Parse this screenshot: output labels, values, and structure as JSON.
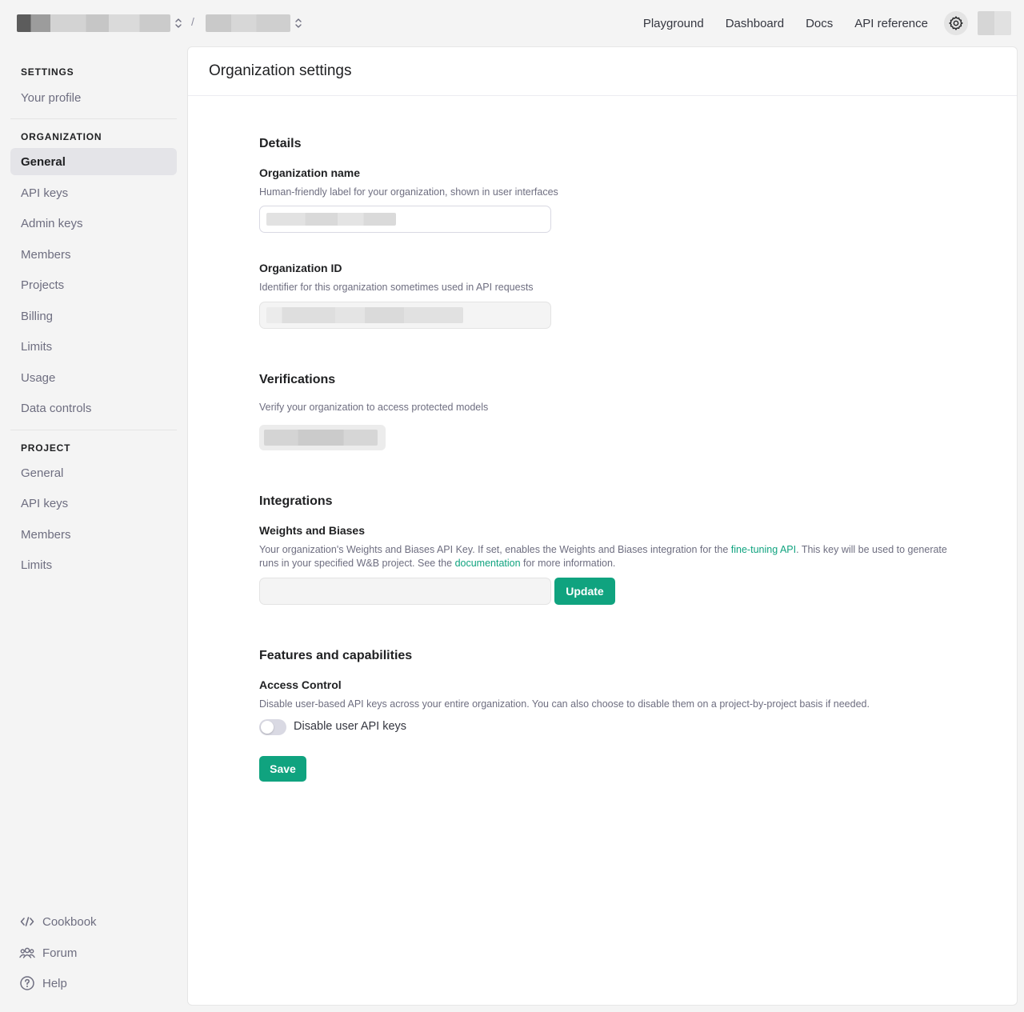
{
  "topnav": {
    "links": [
      "Playground",
      "Dashboard",
      "Docs",
      "API reference"
    ]
  },
  "sidebar": {
    "settings_heading": "SETTINGS",
    "your_profile": "Your profile",
    "organization_heading": "ORGANIZATION",
    "organization_items": [
      "General",
      "API keys",
      "Admin keys",
      "Members",
      "Projects",
      "Billing",
      "Limits",
      "Usage",
      "Data controls"
    ],
    "project_heading": "PROJECT",
    "project_items": [
      "General",
      "API keys",
      "Members",
      "Limits"
    ],
    "bottom_items": {
      "cookbook": "Cookbook",
      "forum": "Forum",
      "help": "Help"
    }
  },
  "main": {
    "title": "Organization settings",
    "details": {
      "title": "Details",
      "org_name_label": "Organization name",
      "org_name_help": "Human-friendly label for your organization, shown in user interfaces",
      "org_id_label": "Organization ID",
      "org_id_help": "Identifier for this organization sometimes used in API requests"
    },
    "verifications": {
      "title": "Verifications",
      "help": "Verify your organization to access protected models"
    },
    "integrations": {
      "title": "Integrations",
      "wandb_label": "Weights and Biases",
      "wandb_help_1": "Your organization's Weights and Biases API Key. If set, enables the Weights and Biases integration for the ",
      "wandb_link_1": "fine-tuning API",
      "wandb_help_2": ". This key will be used to generate runs in your specified W&B project. See the ",
      "wandb_link_2": "documentation",
      "wandb_help_3": " for more information.",
      "update_button": "Update"
    },
    "features": {
      "title": "Features and capabilities",
      "access_control_label": "Access Control",
      "access_control_help": "Disable user-based API keys across your entire organization. You can also choose to disable them on a project-by-project basis if needed.",
      "toggle_label": "Disable user API keys",
      "toggle_on": false
    },
    "save_button": "Save"
  },
  "colors": {
    "accent": "#10a37f",
    "active_bg": "#e4e4e8",
    "muted_text": "#6e6e80"
  }
}
